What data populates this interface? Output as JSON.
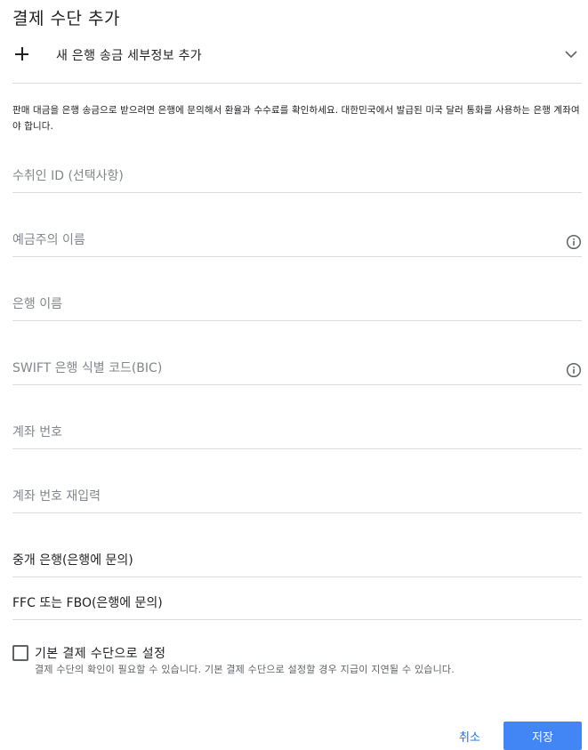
{
  "dialog": {
    "title": "결제 수단 추가"
  },
  "add_transfer": {
    "label": "새 은행 송금 세부정보 추가",
    "plus_icon": "plus-icon",
    "chevron_icon": "chevron-down-icon"
  },
  "notice": "판매 대금을 은행 송금으로 받으려면 은행에 문의해서 환율과 수수료를 확인하세요. 대한민국에서 발급된 미국 달러 통화를 사용하는 은행 계좌여야 합니다.",
  "fields": {
    "payee_id": {
      "placeholder": "수취인 ID (선택사항)",
      "value": ""
    },
    "account_holder": {
      "placeholder": "예금주의 이름",
      "value": "",
      "icon": "info-icon"
    },
    "bank_name": {
      "placeholder": "은행 이름",
      "value": ""
    },
    "swift": {
      "placeholder": "SWIFT 은행 식별 코드(BIC)",
      "value": "",
      "icon": "info-icon"
    },
    "account_number": {
      "placeholder": "계좌 번호",
      "value": ""
    },
    "account_number_confirm": {
      "placeholder": "계좌 번호 재입력",
      "value": ""
    },
    "intermediary_bank": {
      "placeholder": "중개 은행(은행에 문의)",
      "value": ""
    },
    "ffc_fbo": {
      "placeholder": "FFC 또는 FBO(은행에 문의)",
      "value": ""
    }
  },
  "default_option": {
    "label": "기본 결제 수단으로 설정",
    "help": "결제 수단의 확인이 필요할 수 있습니다. 기본 결제 수단으로 설정할 경우 지급이 지연될 수 있습니다.",
    "checked": false
  },
  "actions": {
    "cancel_label": "취소",
    "save_label": "저장"
  },
  "colors": {
    "accent": "#4285f4",
    "link": "#1a73e8",
    "divider": "#dadce0"
  }
}
